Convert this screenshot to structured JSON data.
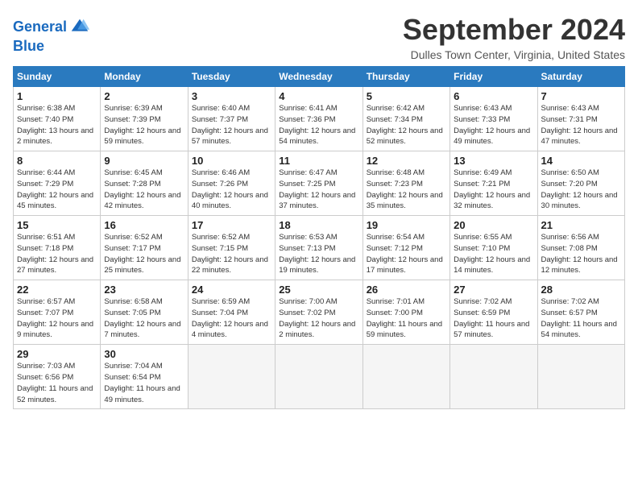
{
  "header": {
    "logo_line1": "General",
    "logo_line2": "Blue",
    "title": "September 2024",
    "location": "Dulles Town Center, Virginia, United States"
  },
  "weekdays": [
    "Sunday",
    "Monday",
    "Tuesday",
    "Wednesday",
    "Thursday",
    "Friday",
    "Saturday"
  ],
  "weeks": [
    [
      {
        "day": "1",
        "sunrise": "6:38 AM",
        "sunset": "7:40 PM",
        "daylight": "13 hours and 2 minutes."
      },
      {
        "day": "2",
        "sunrise": "6:39 AM",
        "sunset": "7:39 PM",
        "daylight": "12 hours and 59 minutes."
      },
      {
        "day": "3",
        "sunrise": "6:40 AM",
        "sunset": "7:37 PM",
        "daylight": "12 hours and 57 minutes."
      },
      {
        "day": "4",
        "sunrise": "6:41 AM",
        "sunset": "7:36 PM",
        "daylight": "12 hours and 54 minutes."
      },
      {
        "day": "5",
        "sunrise": "6:42 AM",
        "sunset": "7:34 PM",
        "daylight": "12 hours and 52 minutes."
      },
      {
        "day": "6",
        "sunrise": "6:43 AM",
        "sunset": "7:33 PM",
        "daylight": "12 hours and 49 minutes."
      },
      {
        "day": "7",
        "sunrise": "6:43 AM",
        "sunset": "7:31 PM",
        "daylight": "12 hours and 47 minutes."
      }
    ],
    [
      {
        "day": "8",
        "sunrise": "6:44 AM",
        "sunset": "7:29 PM",
        "daylight": "12 hours and 45 minutes."
      },
      {
        "day": "9",
        "sunrise": "6:45 AM",
        "sunset": "7:28 PM",
        "daylight": "12 hours and 42 minutes."
      },
      {
        "day": "10",
        "sunrise": "6:46 AM",
        "sunset": "7:26 PM",
        "daylight": "12 hours and 40 minutes."
      },
      {
        "day": "11",
        "sunrise": "6:47 AM",
        "sunset": "7:25 PM",
        "daylight": "12 hours and 37 minutes."
      },
      {
        "day": "12",
        "sunrise": "6:48 AM",
        "sunset": "7:23 PM",
        "daylight": "12 hours and 35 minutes."
      },
      {
        "day": "13",
        "sunrise": "6:49 AM",
        "sunset": "7:21 PM",
        "daylight": "12 hours and 32 minutes."
      },
      {
        "day": "14",
        "sunrise": "6:50 AM",
        "sunset": "7:20 PM",
        "daylight": "12 hours and 30 minutes."
      }
    ],
    [
      {
        "day": "15",
        "sunrise": "6:51 AM",
        "sunset": "7:18 PM",
        "daylight": "12 hours and 27 minutes."
      },
      {
        "day": "16",
        "sunrise": "6:52 AM",
        "sunset": "7:17 PM",
        "daylight": "12 hours and 25 minutes."
      },
      {
        "day": "17",
        "sunrise": "6:52 AM",
        "sunset": "7:15 PM",
        "daylight": "12 hours and 22 minutes."
      },
      {
        "day": "18",
        "sunrise": "6:53 AM",
        "sunset": "7:13 PM",
        "daylight": "12 hours and 19 minutes."
      },
      {
        "day": "19",
        "sunrise": "6:54 AM",
        "sunset": "7:12 PM",
        "daylight": "12 hours and 17 minutes."
      },
      {
        "day": "20",
        "sunrise": "6:55 AM",
        "sunset": "7:10 PM",
        "daylight": "12 hours and 14 minutes."
      },
      {
        "day": "21",
        "sunrise": "6:56 AM",
        "sunset": "7:08 PM",
        "daylight": "12 hours and 12 minutes."
      }
    ],
    [
      {
        "day": "22",
        "sunrise": "6:57 AM",
        "sunset": "7:07 PM",
        "daylight": "12 hours and 9 minutes."
      },
      {
        "day": "23",
        "sunrise": "6:58 AM",
        "sunset": "7:05 PM",
        "daylight": "12 hours and 7 minutes."
      },
      {
        "day": "24",
        "sunrise": "6:59 AM",
        "sunset": "7:04 PM",
        "daylight": "12 hours and 4 minutes."
      },
      {
        "day": "25",
        "sunrise": "7:00 AM",
        "sunset": "7:02 PM",
        "daylight": "12 hours and 2 minutes."
      },
      {
        "day": "26",
        "sunrise": "7:01 AM",
        "sunset": "7:00 PM",
        "daylight": "11 hours and 59 minutes."
      },
      {
        "day": "27",
        "sunrise": "7:02 AM",
        "sunset": "6:59 PM",
        "daylight": "11 hours and 57 minutes."
      },
      {
        "day": "28",
        "sunrise": "7:02 AM",
        "sunset": "6:57 PM",
        "daylight": "11 hours and 54 minutes."
      }
    ],
    [
      {
        "day": "29",
        "sunrise": "7:03 AM",
        "sunset": "6:56 PM",
        "daylight": "11 hours and 52 minutes."
      },
      {
        "day": "30",
        "sunrise": "7:04 AM",
        "sunset": "6:54 PM",
        "daylight": "11 hours and 49 minutes."
      },
      null,
      null,
      null,
      null,
      null
    ]
  ]
}
